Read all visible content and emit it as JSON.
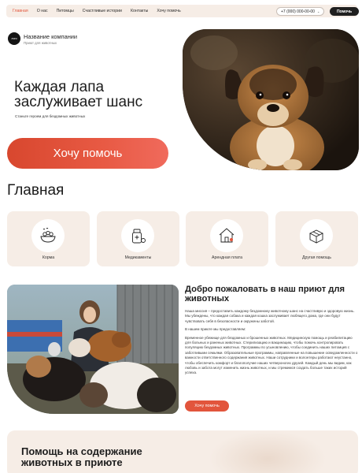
{
  "nav": {
    "items": [
      {
        "label": "Главная",
        "active": true
      },
      {
        "label": "О нас",
        "active": false
      },
      {
        "label": "Питомцы",
        "active": false
      },
      {
        "label": "Счастливые истории",
        "active": false
      },
      {
        "label": "Контакты",
        "active": false
      },
      {
        "label": "Хочу помочь",
        "active": false
      }
    ],
    "phone": "+7 (000) 000-00-00",
    "help_button": "Помочь"
  },
  "brand": {
    "logo": "лого",
    "name": "Название компании",
    "subtitle": "Приют для животных"
  },
  "hero": {
    "title": "Каждая лапа заслуживает шанс",
    "subtitle": "Станьте героем для бездомных животных",
    "button": "Хочу помочь"
  },
  "main": {
    "title": "Главная",
    "cards": [
      {
        "label": "Корма",
        "icon": "pet-food-bowl-icon"
      },
      {
        "label": "Медикаменты",
        "icon": "medicine-bottle-icon"
      },
      {
        "label": "Арендная плата",
        "icon": "house-rent-icon"
      },
      {
        "label": "Другая помощь",
        "icon": "donation-box-icon"
      }
    ]
  },
  "welcome": {
    "title": "Добро пожаловать в наш приют для животных",
    "paragraphs": [
      "Наша миссия – предоставить каждому бездомному животному шанс на счастливую и здоровую жизнь. Мы убеждены, что каждая собака и каждая кошка заслуживает любящего дома, где они будут чувствовать себя в безопасности и окружены заботой.",
      "В нашем приюте мы предоставляем:",
      "Временное убежище для бездомных и брошенных животных. Медицинскую помощь и реабилитацию для больных и раненых животных. Стерилизацию и вакцинацию, чтобы помочь контролировать популяцию бездомных животных. Программы по усыновлению, чтобы соединить наших питомцев с заботливыми семьями. Образовательные программы, направленные на повышение осведомленности о важности ответственного содержания животных. Наши сотрудники и волонтеры работают неустанно, чтобы обеспечить комфорт и благополучие наших четвероногих друзей. Каждый день мы видим, как любовь и забота могут изменить жизнь животных, и мы стремимся создать больше таких историй успеха."
    ],
    "button": "Хочу помочь"
  },
  "bottom": {
    "title": "Помощь на содержание животных в приюте"
  },
  "colors": {
    "accent": "#e2553c",
    "card_bg": "#f6ede6",
    "dark": "#1f1f1f"
  }
}
